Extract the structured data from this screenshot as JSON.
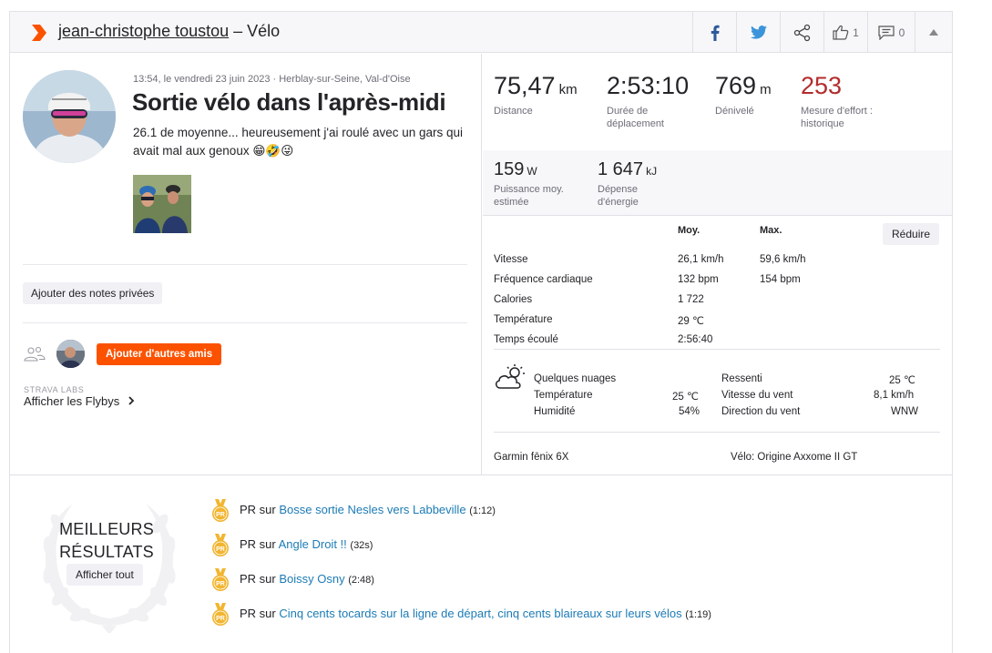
{
  "header": {
    "athlete": "jean-christophe toustou",
    "separator": " – ",
    "sport": "Vélo",
    "kudos_count": "1",
    "comments_count": "0"
  },
  "activity": {
    "meta": "13:54, le vendredi 23 juin 2023 · Herblay-sur-Seine, Val-d'Oise",
    "title": "Sortie vélo dans l'après-midi",
    "description": "26.1 de moyenne... heureusement j'ai roulé avec un gars qui avait mal aux genoux 😁🤣😜",
    "private_notes_label": "Ajouter des notes privées",
    "add_friends_label": "Ajouter d'autres amis",
    "labs_label": "STRAVA LABS",
    "flyby_label": "Afficher les Flybys"
  },
  "stats": {
    "distance": {
      "value": "75,47",
      "unit": "km",
      "label": "Distance"
    },
    "moving_time": {
      "value": "2:53:10",
      "label": "Durée de déplacement"
    },
    "elevation": {
      "value": "769",
      "unit": "m",
      "label": "Dénivelé"
    },
    "effort": {
      "value": "253",
      "label": "Mesure d'effort : historique"
    },
    "power": {
      "value": "159",
      "unit": "W",
      "label": "Puissance moy. estimée"
    },
    "energy": {
      "value": "1 647",
      "unit": "kJ",
      "label": "Dépense d'énergie"
    }
  },
  "details": {
    "col_avg": "Moy.",
    "col_max": "Max.",
    "reduce_label": "Réduire",
    "rows": [
      {
        "label": "Vitesse",
        "avg": "26,1 km/h",
        "max": "59,6 km/h"
      },
      {
        "label": "Fréquence cardiaque",
        "avg": "132 bpm",
        "max": "154 bpm"
      },
      {
        "label": "Calories",
        "avg": "1 722",
        "max": ""
      },
      {
        "label": "Température",
        "avg": "29 ℃",
        "max": ""
      },
      {
        "label": "Temps écoulé",
        "avg": "2:56:40",
        "max": ""
      }
    ]
  },
  "weather": {
    "condition": "Quelques nuages",
    "temp_label": "Température",
    "temp_value": "25 ℃",
    "humidity_label": "Humidité",
    "humidity_value": "54%",
    "feels_label": "Ressenti",
    "feels_value": "25 ℃",
    "wind_speed_label": "Vitesse du vent",
    "wind_speed_value": "8,1 km/h",
    "wind_dir_label": "Direction du vent",
    "wind_dir_value": "WNW"
  },
  "gear": {
    "device": "Garmin fēnix 6X",
    "bike": "Vélo: Origine Axxome II GT"
  },
  "best_efforts": {
    "title_line1": "MEILLEURS",
    "title_line2": "RÉSULTATS",
    "show_all_label": "Afficher tout",
    "medal_text": "PR",
    "items": [
      {
        "prefix": "PR sur ",
        "segment": "Bosse sortie Nesles vers Labbeville",
        "time": "(1:12)"
      },
      {
        "prefix": "PR sur ",
        "segment": "Angle Droit !!",
        "time": "(32s)"
      },
      {
        "prefix": "PR sur ",
        "segment": "Boissy Osny",
        "time": "(2:48)"
      },
      {
        "prefix": "PR sur ",
        "segment": "Cinq cents tocards sur la ligne de départ, cinq cents blaireaux sur leurs vélos",
        "time": "(1:19)"
      }
    ]
  },
  "colors": {
    "brand": "#fc5200",
    "effort_red": "#b32c2c",
    "link_blue": "#1c7bb5",
    "medal_gold": "#f2b530"
  }
}
